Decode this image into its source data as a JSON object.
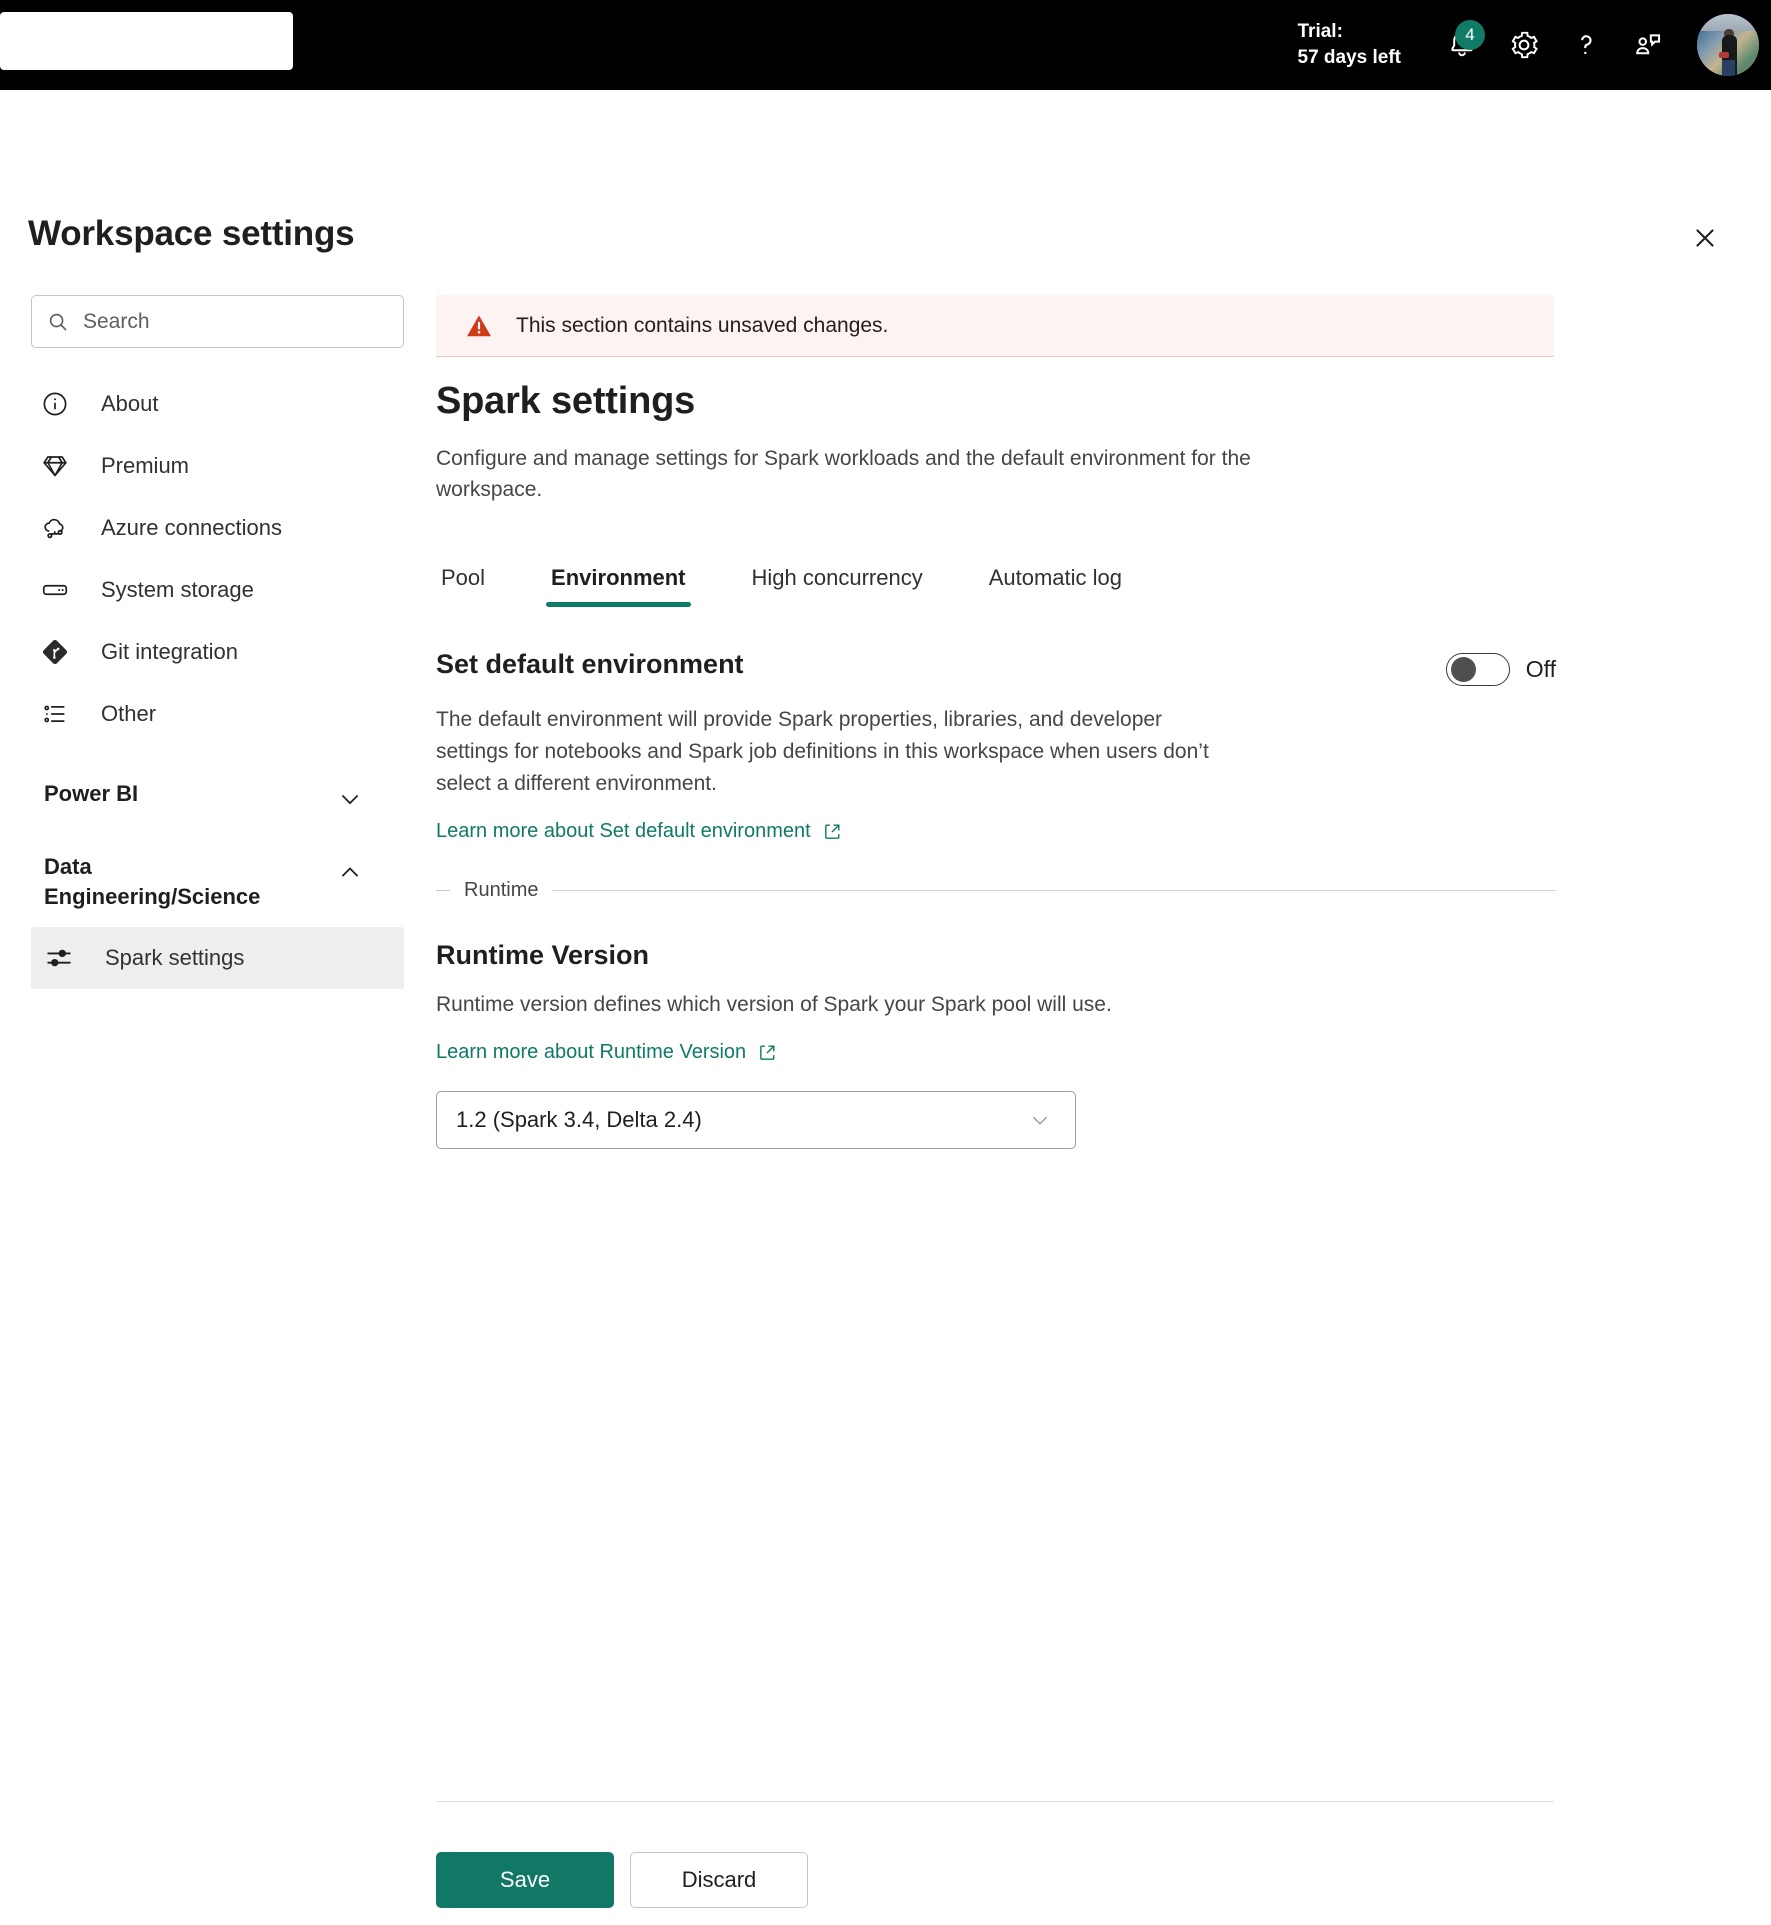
{
  "topbar": {
    "search_box_value": "",
    "trial_line1": "Trial:",
    "trial_line2": "57 days left",
    "notifications_badge": "4",
    "icons": {
      "bell": "notifications-bell-icon",
      "gear": "settings-gear-icon",
      "help": "help-question-icon",
      "feedback": "feedback-person-icon",
      "avatar": "user-avatar"
    },
    "accent_teal": "#107c67"
  },
  "panel": {
    "title": "Workspace settings",
    "close_label": "Close"
  },
  "sidebar": {
    "search": {
      "value": "",
      "placeholder": "Search"
    },
    "items": [
      {
        "label": "About",
        "icon": "info-circle-icon"
      },
      {
        "label": "Premium",
        "icon": "diamond-icon"
      },
      {
        "label": "Azure connections",
        "icon": "cloud-link-icon"
      },
      {
        "label": "System storage",
        "icon": "storage-drive-icon"
      },
      {
        "label": "Git integration",
        "icon": "git-icon"
      },
      {
        "label": "Other",
        "icon": "list-bullets-icon"
      }
    ],
    "groups": [
      {
        "label": "Power BI",
        "expanded": false,
        "chevron": "chevron-down-icon",
        "children": []
      },
      {
        "label": "Data Engineering/Science",
        "expanded": true,
        "chevron": "chevron-up-icon",
        "children": [
          {
            "label": "Spark settings",
            "icon": "sliders-icon",
            "selected": true
          }
        ]
      }
    ]
  },
  "content": {
    "banner": {
      "icon": "warning-triangle-icon",
      "text": "This section contains unsaved changes.",
      "bg": "#fdf3f2",
      "icon_color": "#d13438"
    },
    "title": "Spark settings",
    "subtitle": "Configure and manage settings for Spark workloads and the default environment for the workspace.",
    "tabs": [
      {
        "label": "Pool",
        "active": false
      },
      {
        "label": "Environment",
        "active": true
      },
      {
        "label": "High concurrency",
        "active": false
      },
      {
        "label": "Automatic log",
        "active": false
      }
    ],
    "default_environment": {
      "title": "Set default environment",
      "toggle_state": "Off",
      "description": "The default environment will provide Spark properties, libraries, and developer settings for notebooks and Spark job definitions in this workspace when users don’t select a different environment.",
      "learn_more": "Learn more about Set default environment",
      "learn_more_icon": "external-link-icon"
    },
    "runtime_fieldset_legend": "Runtime",
    "runtime_version": {
      "title": "Runtime Version",
      "description": "Runtime version defines which version of Spark your Spark pool will use.",
      "learn_more": "Learn more about Runtime Version",
      "learn_more_icon": "external-link-icon",
      "selected_value": "1.2 (Spark 3.4, Delta 2.4)",
      "chevron": "chevron-down-icon"
    }
  },
  "footer": {
    "save_label": "Save",
    "discard_label": "Discard",
    "primary_color": "#117865"
  }
}
